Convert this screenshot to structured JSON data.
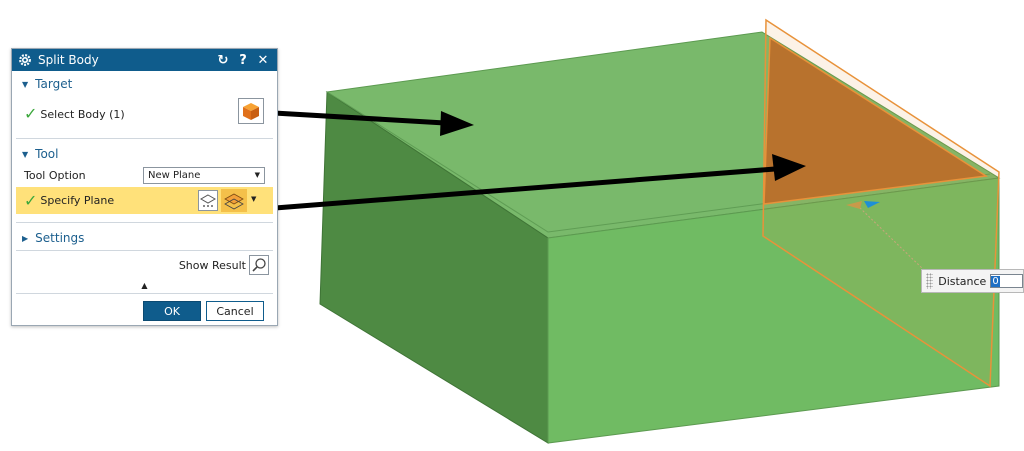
{
  "dialog": {
    "title": "Split Body",
    "title_buttons": [
      "reset",
      "help",
      "close"
    ],
    "help_glyph": "?",
    "close_glyph": "✕",
    "reset_glyph": "↻",
    "sections": {
      "target": {
        "label": "Target",
        "select_body_label": "Select Body (1)"
      },
      "tool": {
        "label": "Tool",
        "tool_option_label": "Tool Option",
        "tool_option_value": "New Plane",
        "specify_plane_label": "Specify Plane"
      },
      "settings": {
        "label": "Settings"
      }
    },
    "show_result_label": "Show Result",
    "ok_label": "OK",
    "cancel_label": "Cancel"
  },
  "viewport": {
    "distance_label": "Distance",
    "distance_value": "0"
  },
  "colors": {
    "titlebar": "#0f5c8c",
    "section_text": "#1c5f8e",
    "highlight_row": "#ffe17a",
    "ok_button": "#0f5c8c",
    "body_top": "#79b96b",
    "body_front": "#6fbb62",
    "body_side": "#4f8a43",
    "plane_fill": "#b8722d",
    "plane_edge": "#e8923a"
  }
}
